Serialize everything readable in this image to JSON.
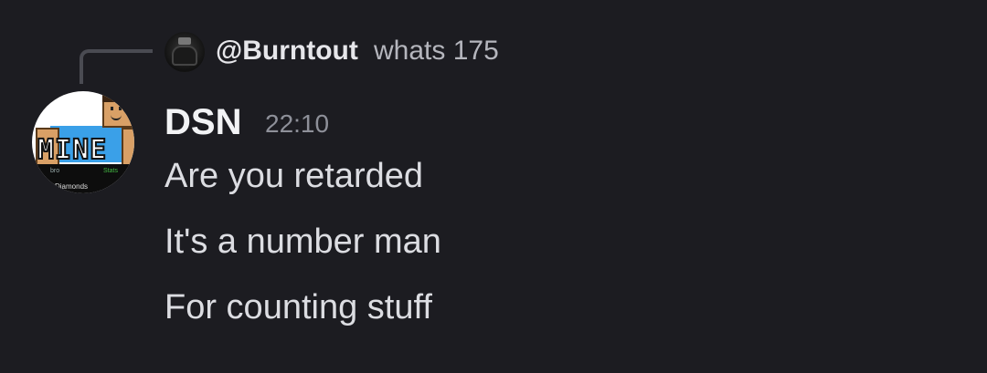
{
  "reply": {
    "username": "@Burntout",
    "text": "whats 175"
  },
  "avatar": {
    "banner_text": "MINE",
    "stat_left": "bro",
    "stat_right": "Stats",
    "footer": "Diamonds"
  },
  "message": {
    "author": "DSN",
    "timestamp": "22:10",
    "lines": [
      "Are you retarded",
      "It's a number man",
      "For counting stuff"
    ]
  }
}
